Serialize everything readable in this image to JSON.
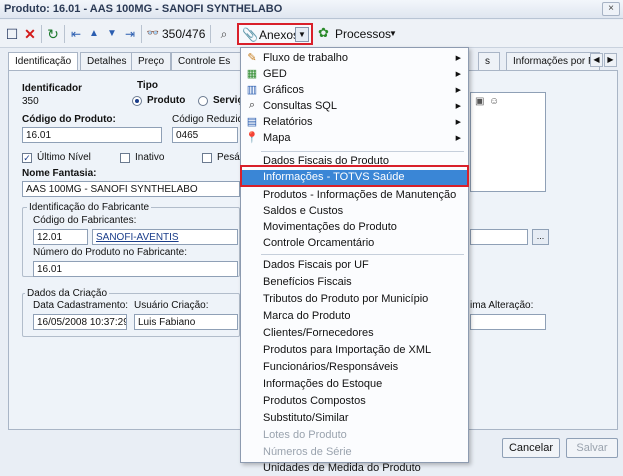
{
  "window": {
    "title": "Produto: 16.01 - AAS 100MG - SANOFI SYNTHELABO",
    "close_glyph": "×"
  },
  "toolbar": {
    "counter": "350/476",
    "anexos_label": "Anexos",
    "processos_label": "Processos"
  },
  "tabs": [
    "Identificação",
    "Detalhes",
    "Preço",
    "Controle Es",
    "s",
    "Informações por Fili"
  ],
  "form": {
    "identificador_label": "Identificador",
    "identificador_value": "350",
    "tipo_label": "Tipo",
    "tipo_produto": "Produto",
    "tipo_servico": "Serviç",
    "codigo_produto_label": "Código do Produto:",
    "codigo_produto_value": "16.01",
    "codigo_reduzido_label": "Código Reduzido:",
    "codigo_reduzido_value": "0465",
    "ultimo_nivel_label": "Último Nível",
    "inativo_label": "Inativo",
    "pesavel_label": "Pesáv",
    "nome_fantasia_label": "Nome Fantasia:",
    "nome_fantasia_value": "AAS 100MG - SANOFI SYNTHELABO",
    "fabricante_group": "Identificação do Fabricante",
    "codigo_fabricantes_label": "Código do Fabricantes:",
    "codigo_fabricantes_value": "12.01",
    "fabricante_link": "SANOFI-AVENTIS",
    "numero_produto_label": "Número do Produto no Fabricante:",
    "numero_produto_value": "16.01",
    "criacao_group": "Dados da Criação",
    "data_cadastramento_label": "Data Cadastramento:",
    "data_cadastramento_value": "16/05/2008 10:37:29",
    "usuario_criacao_label": "Usuário Criação:",
    "usuario_criacao_value": "Luis Fabiano",
    "ultima_alteracao_label": "ima Alteração:",
    "ellipsis": "..."
  },
  "footer": {
    "cancelar": "Cancelar",
    "salvar": "Salvar"
  },
  "menu": {
    "submenus": [
      "Fluxo de trabalho",
      "GED",
      "Gráficos",
      "Consultas SQL",
      "Relatórios",
      "Mapa"
    ],
    "group1": [
      "Dados Fiscais do Produto",
      "Informações - TOTVS Saúde",
      "Produtos - Informações de Manutenção",
      "Saldos e Custos",
      "Movimentações do Produto",
      "Controle Orcamentário"
    ],
    "group2": [
      "Dados Fiscais por UF",
      "Benefícios Fiscais",
      "Tributos do Produto por Município",
      "Marca do Produto",
      "Clientes/Fornecedores",
      "Produtos para Importação de XML",
      "Funcionários/Responsáveis",
      "Informações do Estoque",
      "Produtos Compostos",
      "Substituto/Similar",
      "Lotes do Produto",
      "Números de Série",
      "Unidades de Medida do Produto"
    ]
  },
  "colors": {
    "highlight": "#3a86d6",
    "annotation_red": "#d9202a"
  }
}
